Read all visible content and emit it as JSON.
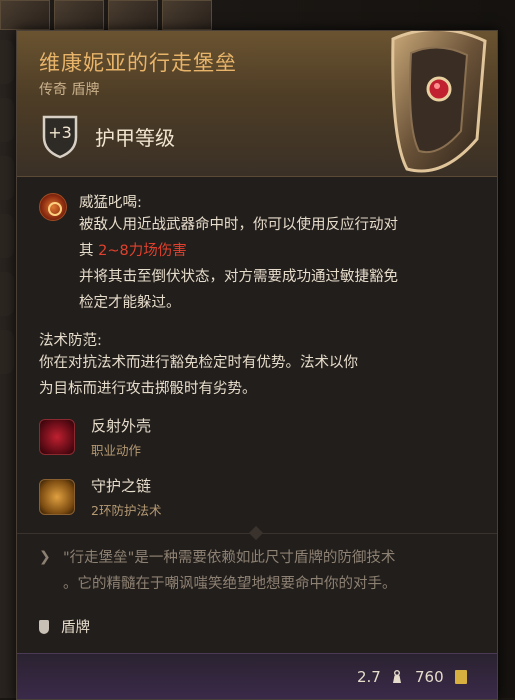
{
  "item": {
    "title": "维康妮亚的行走堡垒",
    "subtitle": "传奇 盾牌",
    "armor_class_value": "+3",
    "armor_class_label": "护甲等级"
  },
  "passive_1": {
    "name": "威猛叱喝:",
    "line1": "被敌人用近战武器命中时，你可以使用反应行动对",
    "line2_prefix": "其 ",
    "line2_damage": "2~8力场伤害",
    "line3": "并将其击至倒伏状态，对方需要成功通过敏捷豁免",
    "line4": "检定才能躲过。"
  },
  "passive_2": {
    "name": "法术防范:",
    "line1": "你在对抗法术而进行豁免检定时有优势。法术以你",
    "line2": "为目标而进行攻击掷骰时有劣势。"
  },
  "actions": [
    {
      "name": "反射外壳",
      "type": "职业动作",
      "icon": "reflective-shell-icon"
    },
    {
      "name": "守护之链",
      "type": "2环防护法术",
      "icon": "warding-bond-icon"
    }
  ],
  "flavor": {
    "line1": "\"行走堡垒\"是一种需要依赖如此尺寸盾牌的防御技术",
    "line2": "。它的精髓在于嘲讽嗤笑绝望地想要命中你的对手。"
  },
  "category": {
    "label": "盾牌",
    "icon": "shield-icon"
  },
  "footer": {
    "weight": "2.7",
    "value": "760"
  },
  "colors": {
    "title": "#e8b46a",
    "damage": "#e0412e",
    "footer_bg": "#3b2a4a"
  }
}
